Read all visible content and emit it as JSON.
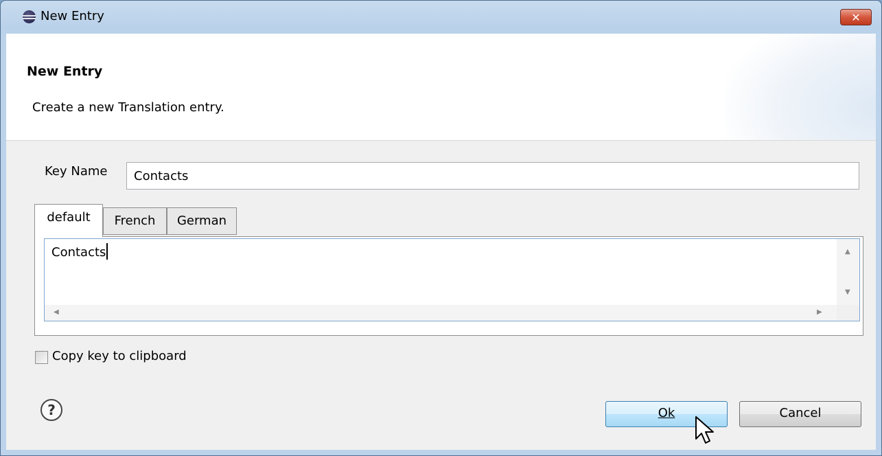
{
  "window": {
    "title": "New Entry",
    "close_label": "✕"
  },
  "header": {
    "title": "New Entry",
    "description": "Create a new Translation entry."
  },
  "form": {
    "key_label": "Key Name",
    "key_value": "Contacts"
  },
  "tabs": [
    {
      "label": "default",
      "active": true
    },
    {
      "label": "French",
      "active": false
    },
    {
      "label": "German",
      "active": false
    }
  ],
  "editor": {
    "text": "Contacts"
  },
  "checkbox": {
    "label": "Copy key to clipboard",
    "checked": false
  },
  "buttons": {
    "ok_label": "Ok",
    "cancel_label": "Cancel",
    "help_label": "?"
  },
  "colors": {
    "frame": "#b9d1ea",
    "close": "#c03b20",
    "focus_border": "#3c7fb1"
  }
}
